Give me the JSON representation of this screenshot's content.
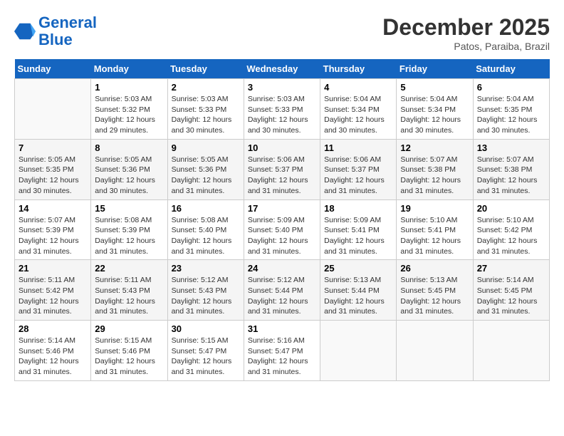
{
  "header": {
    "logo_line1": "General",
    "logo_line2": "Blue",
    "title": "December 2025",
    "subtitle": "Patos, Paraiba, Brazil"
  },
  "days_of_week": [
    "Sunday",
    "Monday",
    "Tuesday",
    "Wednesday",
    "Thursday",
    "Friday",
    "Saturday"
  ],
  "weeks": [
    [
      {
        "num": "",
        "info": ""
      },
      {
        "num": "1",
        "info": "Sunrise: 5:03 AM\nSunset: 5:32 PM\nDaylight: 12 hours\nand 29 minutes."
      },
      {
        "num": "2",
        "info": "Sunrise: 5:03 AM\nSunset: 5:33 PM\nDaylight: 12 hours\nand 30 minutes."
      },
      {
        "num": "3",
        "info": "Sunrise: 5:03 AM\nSunset: 5:33 PM\nDaylight: 12 hours\nand 30 minutes."
      },
      {
        "num": "4",
        "info": "Sunrise: 5:04 AM\nSunset: 5:34 PM\nDaylight: 12 hours\nand 30 minutes."
      },
      {
        "num": "5",
        "info": "Sunrise: 5:04 AM\nSunset: 5:34 PM\nDaylight: 12 hours\nand 30 minutes."
      },
      {
        "num": "6",
        "info": "Sunrise: 5:04 AM\nSunset: 5:35 PM\nDaylight: 12 hours\nand 30 minutes."
      }
    ],
    [
      {
        "num": "7",
        "info": "Sunrise: 5:05 AM\nSunset: 5:35 PM\nDaylight: 12 hours\nand 30 minutes."
      },
      {
        "num": "8",
        "info": "Sunrise: 5:05 AM\nSunset: 5:36 PM\nDaylight: 12 hours\nand 30 minutes."
      },
      {
        "num": "9",
        "info": "Sunrise: 5:05 AM\nSunset: 5:36 PM\nDaylight: 12 hours\nand 31 minutes."
      },
      {
        "num": "10",
        "info": "Sunrise: 5:06 AM\nSunset: 5:37 PM\nDaylight: 12 hours\nand 31 minutes."
      },
      {
        "num": "11",
        "info": "Sunrise: 5:06 AM\nSunset: 5:37 PM\nDaylight: 12 hours\nand 31 minutes."
      },
      {
        "num": "12",
        "info": "Sunrise: 5:07 AM\nSunset: 5:38 PM\nDaylight: 12 hours\nand 31 minutes."
      },
      {
        "num": "13",
        "info": "Sunrise: 5:07 AM\nSunset: 5:38 PM\nDaylight: 12 hours\nand 31 minutes."
      }
    ],
    [
      {
        "num": "14",
        "info": "Sunrise: 5:07 AM\nSunset: 5:39 PM\nDaylight: 12 hours\nand 31 minutes."
      },
      {
        "num": "15",
        "info": "Sunrise: 5:08 AM\nSunset: 5:39 PM\nDaylight: 12 hours\nand 31 minutes."
      },
      {
        "num": "16",
        "info": "Sunrise: 5:08 AM\nSunset: 5:40 PM\nDaylight: 12 hours\nand 31 minutes."
      },
      {
        "num": "17",
        "info": "Sunrise: 5:09 AM\nSunset: 5:40 PM\nDaylight: 12 hours\nand 31 minutes."
      },
      {
        "num": "18",
        "info": "Sunrise: 5:09 AM\nSunset: 5:41 PM\nDaylight: 12 hours\nand 31 minutes."
      },
      {
        "num": "19",
        "info": "Sunrise: 5:10 AM\nSunset: 5:41 PM\nDaylight: 12 hours\nand 31 minutes."
      },
      {
        "num": "20",
        "info": "Sunrise: 5:10 AM\nSunset: 5:42 PM\nDaylight: 12 hours\nand 31 minutes."
      }
    ],
    [
      {
        "num": "21",
        "info": "Sunrise: 5:11 AM\nSunset: 5:42 PM\nDaylight: 12 hours\nand 31 minutes."
      },
      {
        "num": "22",
        "info": "Sunrise: 5:11 AM\nSunset: 5:43 PM\nDaylight: 12 hours\nand 31 minutes."
      },
      {
        "num": "23",
        "info": "Sunrise: 5:12 AM\nSunset: 5:43 PM\nDaylight: 12 hours\nand 31 minutes."
      },
      {
        "num": "24",
        "info": "Sunrise: 5:12 AM\nSunset: 5:44 PM\nDaylight: 12 hours\nand 31 minutes."
      },
      {
        "num": "25",
        "info": "Sunrise: 5:13 AM\nSunset: 5:44 PM\nDaylight: 12 hours\nand 31 minutes."
      },
      {
        "num": "26",
        "info": "Sunrise: 5:13 AM\nSunset: 5:45 PM\nDaylight: 12 hours\nand 31 minutes."
      },
      {
        "num": "27",
        "info": "Sunrise: 5:14 AM\nSunset: 5:45 PM\nDaylight: 12 hours\nand 31 minutes."
      }
    ],
    [
      {
        "num": "28",
        "info": "Sunrise: 5:14 AM\nSunset: 5:46 PM\nDaylight: 12 hours\nand 31 minutes."
      },
      {
        "num": "29",
        "info": "Sunrise: 5:15 AM\nSunset: 5:46 PM\nDaylight: 12 hours\nand 31 minutes."
      },
      {
        "num": "30",
        "info": "Sunrise: 5:15 AM\nSunset: 5:47 PM\nDaylight: 12 hours\nand 31 minutes."
      },
      {
        "num": "31",
        "info": "Sunrise: 5:16 AM\nSunset: 5:47 PM\nDaylight: 12 hours\nand 31 minutes."
      },
      {
        "num": "",
        "info": ""
      },
      {
        "num": "",
        "info": ""
      },
      {
        "num": "",
        "info": ""
      }
    ]
  ]
}
